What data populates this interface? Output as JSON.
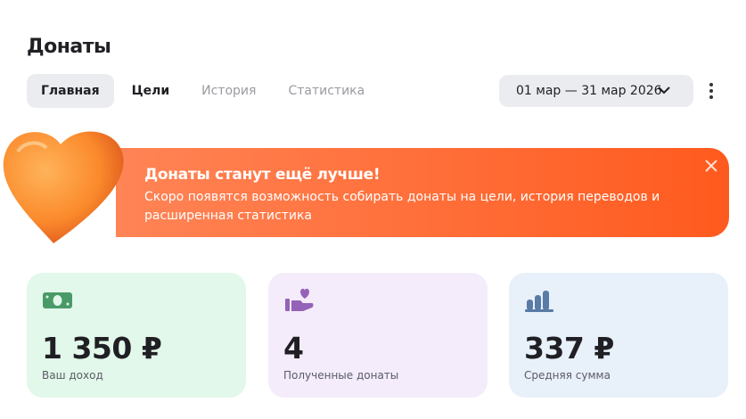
{
  "page": {
    "title": "Донаты"
  },
  "tabs": [
    {
      "label": "Главная"
    },
    {
      "label": "Цели"
    },
    {
      "label": "История"
    },
    {
      "label": "Статистика"
    }
  ],
  "date_range": {
    "label": "01 мар — 31 мар 2026"
  },
  "banner": {
    "title": "Донаты станут ещё лучше!",
    "text": "Скоро появятся возможность собирать донаты на цели, история переводов и расширенная статистика"
  },
  "cards": [
    {
      "value": "1 350 ₽",
      "label": "Ваш доход",
      "icon": "money-icon",
      "bg": "#e2f8ea",
      "color": "#4a9a68"
    },
    {
      "value": "4",
      "label": "Полученные донаты",
      "icon": "hand-heart-icon",
      "bg": "#f4ecfa",
      "color": "#9462b8"
    },
    {
      "value": "337 ₽",
      "label": "Средняя сумма",
      "icon": "bar-chart-icon",
      "bg": "#e8f0fa",
      "color": "#5a7ba6"
    }
  ]
}
